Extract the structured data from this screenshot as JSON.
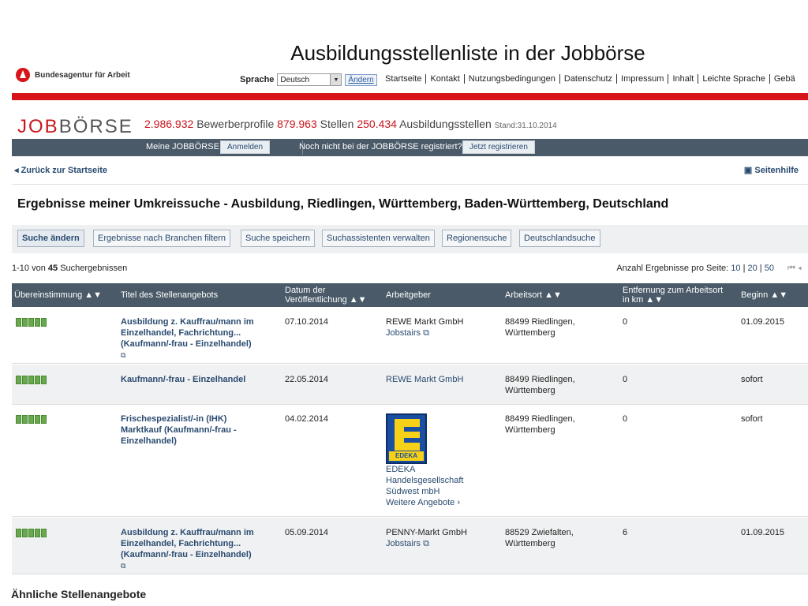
{
  "slide_title": "Ausbildungsstellenliste in der Jobbörse",
  "brand": {
    "name": "Bundesagentur für Arbeit",
    "accent": "#d7141a"
  },
  "language": {
    "label": "Sprache",
    "selected": "Deutsch",
    "change_label": "Ändern"
  },
  "topnav": [
    "Startseite",
    "Kontakt",
    "Nutzungsbedingungen",
    "Datenschutz",
    "Impressum",
    "Inhalt",
    "Leichte Sprache",
    "Gebä"
  ],
  "jobboerse": {
    "logo_a": "JOB",
    "logo_b": "BÖRSE",
    "stat1_num": "2.986.932",
    "stat1_label": "Bewerberprofile",
    "stat2_num": "879.963",
    "stat2_label": "Stellen",
    "stat3_num": "250.434",
    "stat3_label": "Ausbildungsstellen",
    "stand": "Stand:31.10.2014"
  },
  "darkbar": {
    "meine": "Meine JOBBÖRSE",
    "anmelden": "Anmelden",
    "noch_nicht": "Noch nicht bei der JOBBÖRSE registriert?",
    "registrieren": "Jetzt registrieren"
  },
  "back_label": "Zurück zur Startseite",
  "help_label": "Seitenhilfe",
  "heading": "Ergebnisse meiner Umkreissuche - Ausbildung, Riedlingen, Württemberg, Baden-Württemberg, Deutschland",
  "buttons": [
    "Suche ändern",
    "Ergebnisse nach Branchen filtern",
    "Suche speichern",
    "Suchassistenten verwalten",
    "Regionensuche",
    "Deutschlandsuche"
  ],
  "results": {
    "range": "1-10 von",
    "total": "45",
    "suffix": "Suchergebnissen"
  },
  "per_page": {
    "label": "Anzahl Ergebnisse pro Seite:",
    "opt1": "10",
    "opt2": "20",
    "opt3": "50"
  },
  "columns": {
    "match": "Übereinstimmung",
    "title": "Titel des Stellenangebots",
    "date_1": "Datum der",
    "date_2": "Veröffentlichung",
    "employer": "Arbeitgeber",
    "location": "Arbeitsort",
    "distance_1": "Entfernung zum Arbeitsort",
    "distance_2": "in km",
    "start": "Beginn"
  },
  "rows": [
    {
      "title_1": "Ausbildung z. Kauffrau/mann im",
      "title_2": "Einzelhandel, Fachrichtung...",
      "title_3": "(Kaufmann/-frau - Einzelhandel)",
      "date": "07.10.2014",
      "employer": "REWE Markt GmbH",
      "employer_link": "Jobstairs",
      "loc_1": "88499 Riedlingen,",
      "loc_2": "Württemberg",
      "distance": "0",
      "start": "01.09.2015",
      "match": 5
    },
    {
      "title_1": "Kaufmann/-frau - Einzelhandel",
      "date": "22.05.2014",
      "employer_link": "REWE Markt GmbH",
      "loc_1": "88499 Riedlingen,",
      "loc_2": "Württemberg",
      "distance": "0",
      "start": "sofort",
      "match": 5
    },
    {
      "title_1": "Frischespezialist/-in (IHK)",
      "title_2": "Marktkauf (Kaufmann/-frau -",
      "title_3": "Einzelhandel)",
      "date": "04.02.2014",
      "logo_text": "EDEKA",
      "emp_1": "EDEKA",
      "emp_2": "Handelsgesellschaft",
      "emp_3": "Südwest mbH",
      "emp_more": "Weitere Angebote",
      "loc_1": "88499 Riedlingen,",
      "loc_2": "Württemberg",
      "distance": "0",
      "start": "sofort",
      "match": 5
    },
    {
      "title_1": "Ausbildung z. Kauffrau/mann im",
      "title_2": "Einzelhandel, Fachrichtung...",
      "title_3": "(Kaufmann/-frau - Einzelhandel)",
      "date": "05.09.2014",
      "employer": "PENNY-Markt GmbH",
      "employer_link": "Jobstairs",
      "loc_1": "88529 Zwiefalten,",
      "loc_2": "Württemberg",
      "distance": "6",
      "start": "01.09.2015",
      "match": 5
    }
  ],
  "similar": "Ähnliche Stellenangebote"
}
